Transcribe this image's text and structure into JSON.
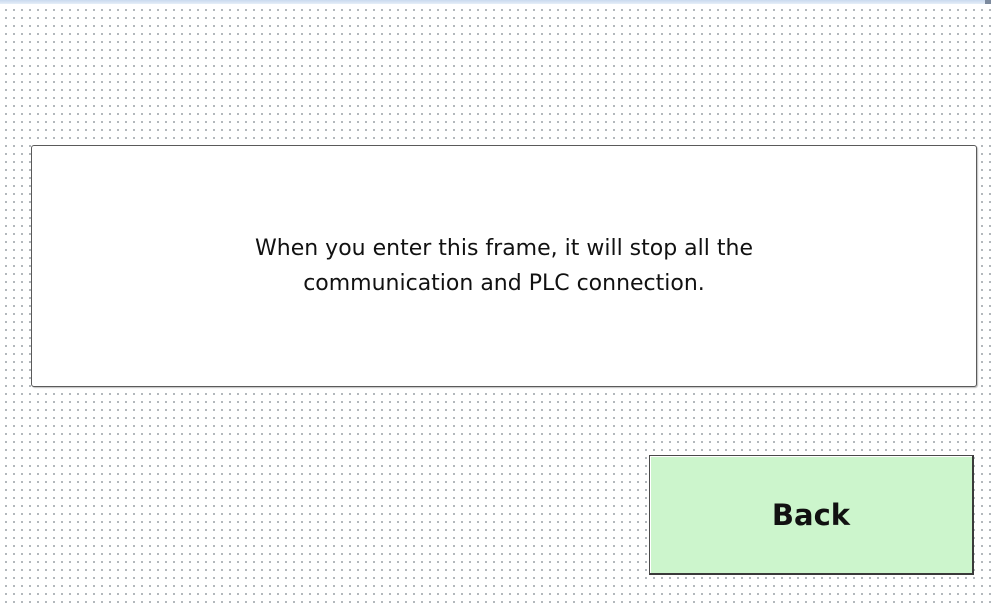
{
  "dialog": {
    "message": "When you enter this frame, it will stop all the\ncommunication and PLC connection."
  },
  "buttons": {
    "back_label": "Back"
  },
  "colors": {
    "back_button_bg": "#ccf5cc",
    "panel_bg": "#ffffff",
    "grid_dot": "#9aa0a6"
  }
}
